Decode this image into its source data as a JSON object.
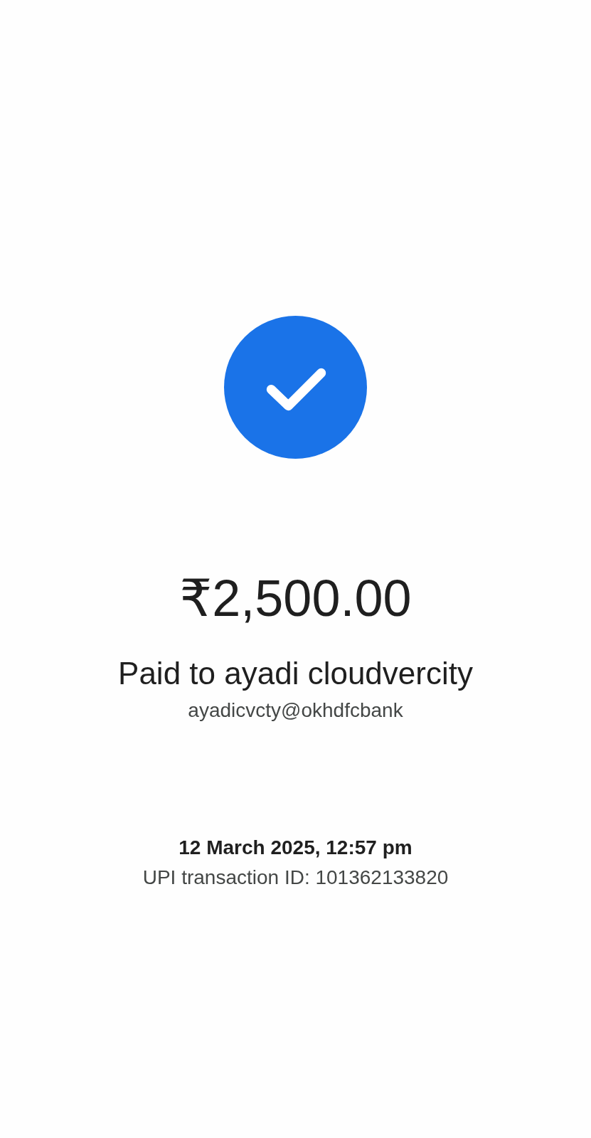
{
  "status": {
    "kind": "success"
  },
  "amount": "₹2,500.00",
  "payee": {
    "label": "Paid to ayadi cloudvercity",
    "upi_id": "ayadicvcty@okhdfcbank"
  },
  "details": {
    "datetime": "12 March 2025, 12:57 pm",
    "transaction_id": "UPI transaction ID: 101362133820"
  }
}
